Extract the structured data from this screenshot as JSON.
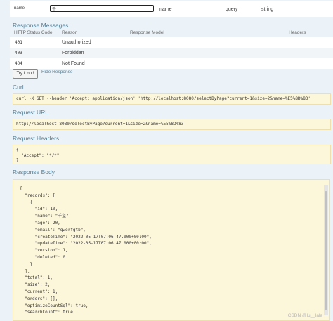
{
  "parameter": {
    "name": "name",
    "value": "千",
    "description": "name",
    "param_type": "query",
    "data_type": "string"
  },
  "response_messages": {
    "title": "Response Messages",
    "columns": [
      "HTTP Status Code",
      "Reason",
      "Response Model",
      "Headers"
    ],
    "rows": [
      {
        "code": "401",
        "reason": "Unauthorized"
      },
      {
        "code": "403",
        "reason": "Forbidden"
      },
      {
        "code": "404",
        "reason": "Not Found"
      }
    ]
  },
  "actions": {
    "try_label": "Try it out!",
    "hide_label": "Hide Response"
  },
  "curl": {
    "title": "Curl",
    "command": "curl -X GET --header 'Accept: application/json' 'http://localhost:8080/selectByPage?current=1&size=2&name=%E5%8D%83'"
  },
  "request_url": {
    "title": "Request URL",
    "url": "http://localhost:8080/selectByPage?current=1&size=2&name=%E5%8D%83"
  },
  "request_headers": {
    "title": "Request Headers",
    "content": "{\n  \"Accept\": \"*/*\"\n}"
  },
  "response_body": {
    "title": "Response Body",
    "content": "{\n  \"records\": [\n    {\n      \"id\": 10,\n      \"name\": \"千玺\",\n      \"age\": 20,\n      \"email\": \"qwerfgtb\",\n      \"createTime\": \"2022-05-17T07:06:47.000+00:00\",\n      \"updateTime\": \"2022-05-17T07:06:47.000+00:00\",\n      \"version\": 1,\n      \"deleted\": 0\n    }\n  ],\n  \"total\": 1,\n  \"size\": 2,\n  \"current\": 1,\n  \"orders\": [],\n  \"optimizeCountSql\": true,\n  \"searchCount\": true,"
  },
  "watermark": "CSDN @lu__lala"
}
